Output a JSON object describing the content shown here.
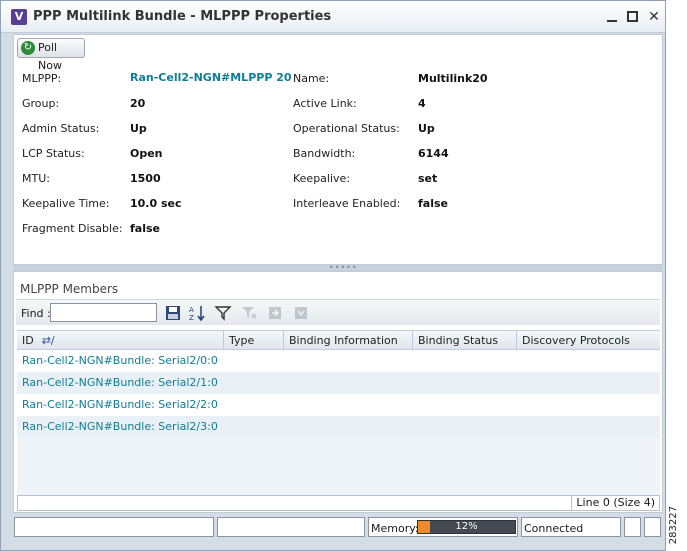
{
  "window": {
    "title": "PPP Multilink Bundle - MLPPP Properties",
    "app_icon_letter": "V"
  },
  "toolbar_top": {
    "poll_label": "Poll Now"
  },
  "properties": {
    "left": [
      {
        "label": "MLPPP:",
        "value": "Ran-Cell2-NGN#MLPPP 20",
        "link": true
      },
      {
        "label": "Group:",
        "value": "20"
      },
      {
        "label": "Admin Status:",
        "value": "Up"
      },
      {
        "label": "LCP Status:",
        "value": "Open"
      },
      {
        "label": "MTU:",
        "value": "1500"
      },
      {
        "label": "Keepalive Time:",
        "value": "10.0 sec"
      },
      {
        "label": "Fragment Disable:",
        "value": "false"
      }
    ],
    "right": [
      {
        "label": "Name:",
        "value": "Multilink20"
      },
      {
        "label": "Active Link:",
        "value": "4"
      },
      {
        "label": "Operational Status:",
        "value": "Up"
      },
      {
        "label": "Bandwidth:",
        "value": "6144"
      },
      {
        "label": "Keepalive:",
        "value": "set"
      },
      {
        "label": "Interleave Enabled:",
        "value": "false"
      }
    ]
  },
  "members": {
    "title": "MLPPP Members",
    "find_label": "Find :",
    "find_value": "",
    "columns": [
      "ID",
      "Type",
      "Binding Information",
      "Binding Status",
      "Discovery Protocols"
    ],
    "rows": [
      "Ran-Cell2-NGN#Bundle: Serial2/0:0",
      "Ran-Cell2-NGN#Bundle: Serial2/1:0",
      "Ran-Cell2-NGN#Bundle: Serial2/2:0",
      "Ran-Cell2-NGN#Bundle: Serial2/3:0"
    ],
    "footer": "Line 0 (Size 4)"
  },
  "status": {
    "memory_label": "Memory:",
    "memory_percent": 12,
    "memory_text": "12%",
    "connection": "Connected"
  },
  "figure_number": "283227",
  "colors": {
    "link": "#0f7d96",
    "memory_fill": "#f08a2a"
  },
  "icons": [
    "poll-icon",
    "save-icon",
    "sort-az-icon",
    "filter-icon",
    "filter-clear-icon",
    "export-icon",
    "import-icon",
    "minimize-icon",
    "maximize-icon",
    "close-icon"
  ]
}
